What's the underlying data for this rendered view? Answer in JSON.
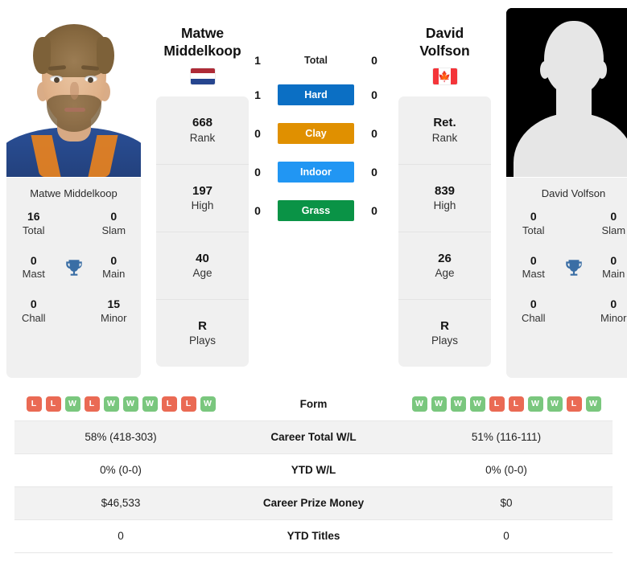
{
  "players": {
    "left": {
      "first_name": "Matwe",
      "last_name": "Middelkoop",
      "full_name": "Matwe Middelkoop",
      "country": "Netherlands",
      "flag_icon": "flag-netherlands",
      "photo_type": "portrait-photo",
      "rank": "668",
      "rank_label": "Rank",
      "high": "197",
      "high_label": "High",
      "age": "40",
      "age_label": "Age",
      "plays": "R",
      "plays_label": "Plays",
      "titles": {
        "total": "16",
        "total_label": "Total",
        "slam": "0",
        "slam_label": "Slam",
        "mast": "0",
        "mast_label": "Mast",
        "main": "0",
        "main_label": "Main",
        "chall": "0",
        "chall_label": "Chall",
        "minor": "15",
        "minor_label": "Minor"
      },
      "form": [
        "L",
        "L",
        "W",
        "L",
        "W",
        "W",
        "W",
        "L",
        "L",
        "W"
      ]
    },
    "right": {
      "first_name": "David",
      "last_name": "Volfson",
      "full_name": "David Volfson",
      "country": "Canada",
      "flag_icon": "flag-canada",
      "photo_type": "silhouette-placeholder",
      "rank": "Ret.",
      "rank_label": "Rank",
      "high": "839",
      "high_label": "High",
      "age": "26",
      "age_label": "Age",
      "plays": "R",
      "plays_label": "Plays",
      "titles": {
        "total": "0",
        "total_label": "Total",
        "slam": "0",
        "slam_label": "Slam",
        "mast": "0",
        "mast_label": "Mast",
        "main": "0",
        "main_label": "Main",
        "chall": "0",
        "chall_label": "Chall",
        "minor": "0",
        "minor_label": "Minor"
      },
      "form": [
        "W",
        "W",
        "W",
        "W",
        "L",
        "L",
        "W",
        "W",
        "L",
        "W"
      ]
    }
  },
  "head_to_head": {
    "rows": [
      {
        "label": "Total",
        "left": "1",
        "right": "0",
        "badge": false,
        "color": ""
      },
      {
        "label": "Hard",
        "left": "1",
        "right": "0",
        "badge": true,
        "color": "#0b6fc4"
      },
      {
        "label": "Clay",
        "left": "0",
        "right": "0",
        "badge": true,
        "color": "#e09000"
      },
      {
        "label": "Indoor",
        "left": "0",
        "right": "0",
        "badge": true,
        "color": "#2196f3"
      },
      {
        "label": "Grass",
        "left": "0",
        "right": "0",
        "badge": true,
        "color": "#0a9346"
      }
    ]
  },
  "comparison_table": {
    "rows": [
      {
        "label": "Form",
        "left": "",
        "right": "",
        "type": "form"
      },
      {
        "label": "Career Total W/L",
        "left": "58% (418-303)",
        "right": "51% (116-111)",
        "type": "text"
      },
      {
        "label": "YTD W/L",
        "left": "0% (0-0)",
        "right": "0% (0-0)",
        "type": "text"
      },
      {
        "label": "Career Prize Money",
        "left": "$46,533",
        "right": "$0",
        "type": "text"
      },
      {
        "label": "YTD Titles",
        "left": "0",
        "right": "0",
        "type": "text"
      }
    ]
  },
  "icons": {
    "trophy": "trophy-icon",
    "trophy_color": "#3a6ea5",
    "maple_leaf": "🍁"
  },
  "colors": {
    "card_bg": "#f0f0f0",
    "row_stripe": "#f2f2f2",
    "win": "#7ac77e",
    "loss": "#ea6a54"
  }
}
